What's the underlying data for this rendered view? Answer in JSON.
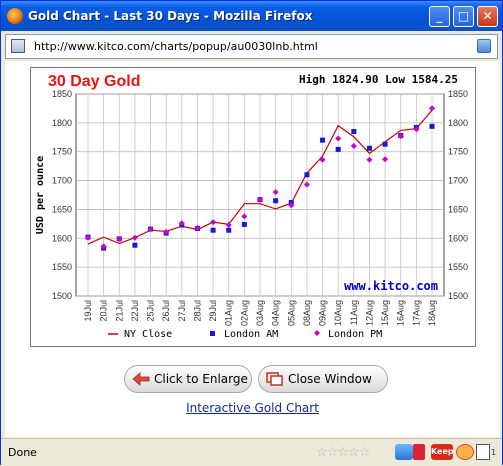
{
  "window": {
    "title": "Gold Chart - Last 30 Days - Mozilla Firefox",
    "minimize_label": "_",
    "maximize_label": "□",
    "close_label": "✕"
  },
  "address": {
    "url": "http://www.kitco.com/charts/popup/au0030lnb.html"
  },
  "buttons": {
    "enlarge_label": "Click to Enlarge",
    "close_window_label": "Close Window"
  },
  "link": {
    "interactive_label": "Interactive Gold Chart"
  },
  "status": {
    "text": "Done",
    "rating_stars": "☆☆☆☆☆",
    "badge_count": "1",
    "keep_label": "Keep"
  },
  "chart_data": {
    "type": "line",
    "title": "30 Day Gold",
    "title_color": "#ee1111",
    "header": "High 1824.90 Low 1584.25",
    "ylabel": "USD per ounce",
    "watermark": "www.kitco.com",
    "watermark_color": "#0000cc",
    "ylim": [
      1500,
      1850
    ],
    "yticks": [
      1500,
      1550,
      1600,
      1650,
      1700,
      1750,
      1800,
      1850
    ],
    "grid": true,
    "legend_position": "bottom",
    "categories": [
      "19Jul",
      "20Jul",
      "21Jul",
      "22Jul",
      "25Jul",
      "26Jul",
      "27Jul",
      "28Jul",
      "29Jul",
      "01Aug",
      "02Aug",
      "03Aug",
      "04Aug",
      "05Aug",
      "08Aug",
      "09Aug",
      "10Aug",
      "11Aug",
      "12Aug",
      "15Aug",
      "16Aug",
      "17Aug",
      "18Aug"
    ],
    "series": [
      {
        "name": "NY Close",
        "color": "#cc0000",
        "style": "line",
        "values": [
          1590,
          1602,
          1591,
          1601,
          1614,
          1612,
          1621,
          1615,
          1628,
          1624,
          1660,
          1660,
          1651,
          1661,
          1713,
          1742,
          1795,
          1776,
          1747,
          1767,
          1787,
          1790,
          1822
        ]
      },
      {
        "name": "London AM",
        "color": "#1a1acc",
        "style": "square",
        "values": [
          1602,
          1583,
          1599,
          1588,
          1616,
          1609,
          1623,
          1617,
          1614,
          1614,
          1624,
          1667,
          1665,
          1662,
          1710,
          1770,
          1754,
          1785,
          1756,
          1763,
          1778,
          1792,
          1794
        ]
      },
      {
        "name": "London PM",
        "color": "#cc00cc",
        "style": "diamond",
        "values": [
          1601,
          1586,
          1599,
          1601,
          1616,
          1611,
          1626,
          1618,
          1628,
          1623,
          1638,
          1667,
          1680,
          1657,
          1693,
          1736,
          1773,
          1760,
          1736,
          1737,
          1777,
          1789,
          1825
        ]
      }
    ]
  }
}
